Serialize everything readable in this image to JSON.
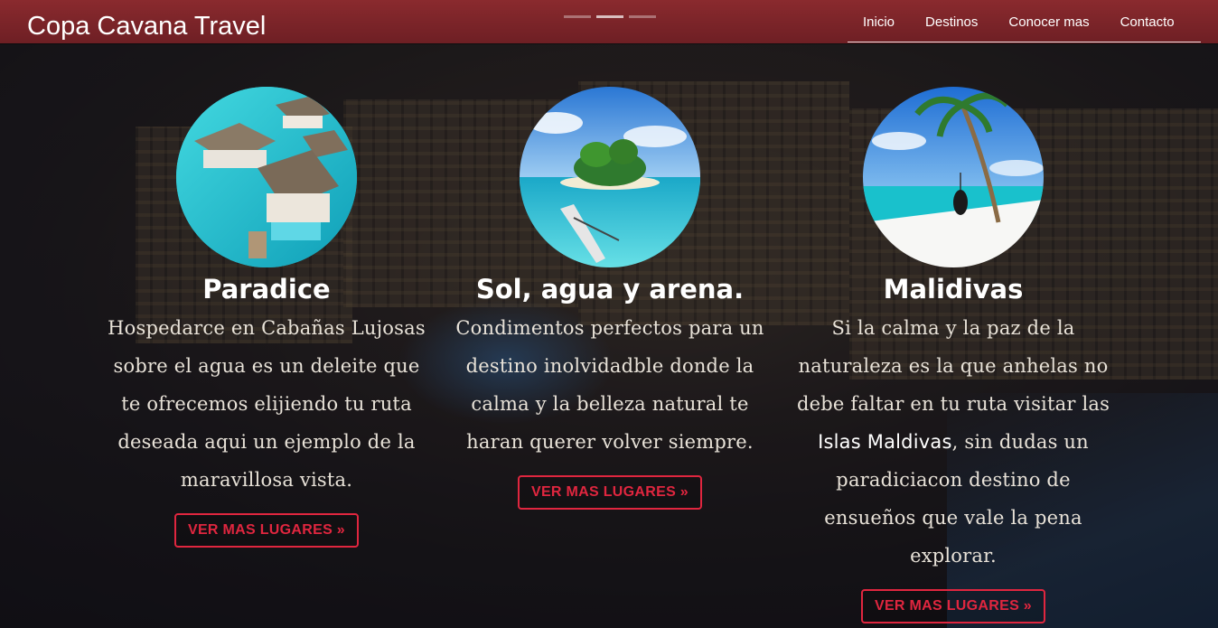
{
  "header": {
    "brand": "Copa Cavana Travel",
    "nav": [
      "Inicio",
      "Destinos",
      "Conocer mas",
      "Contacto"
    ]
  },
  "cards": [
    {
      "title": "Paradice",
      "description": "Hospedarce en Cabañas Lujosas sobre el agua es un deleite que te ofrecemos elijiendo tu ruta deseada aqui un ejemplo de la maravillosa vista.",
      "button": "VER MAS LUGARES »",
      "image_icon": "overwater-bungalow-image"
    },
    {
      "title": "Sol, agua y arena.",
      "description": "Condimentos perfectos para un destino inolvidadble donde la calma y la belleza natural te haran querer volver siempre.",
      "button": "VER MAS LUGARES »",
      "image_icon": "tropical-island-image"
    },
    {
      "title": "Malidivas",
      "description_before": "Si la calma y la paz de la naturaleza es la que anhelas no debe faltar en tu ruta visitar las",
      "description_highlight": "Islas Maldivas",
      "description_after": ", sin dudas un paradiciacon destino de ensueños que vale la pena explorar.",
      "button": "VER MAS LUGARES »",
      "image_icon": "palm-beach-image"
    }
  ],
  "colors": {
    "header_bg": "#7a2328",
    "button_accent": "#e0263f",
    "text_light": "#e8e2d8"
  }
}
